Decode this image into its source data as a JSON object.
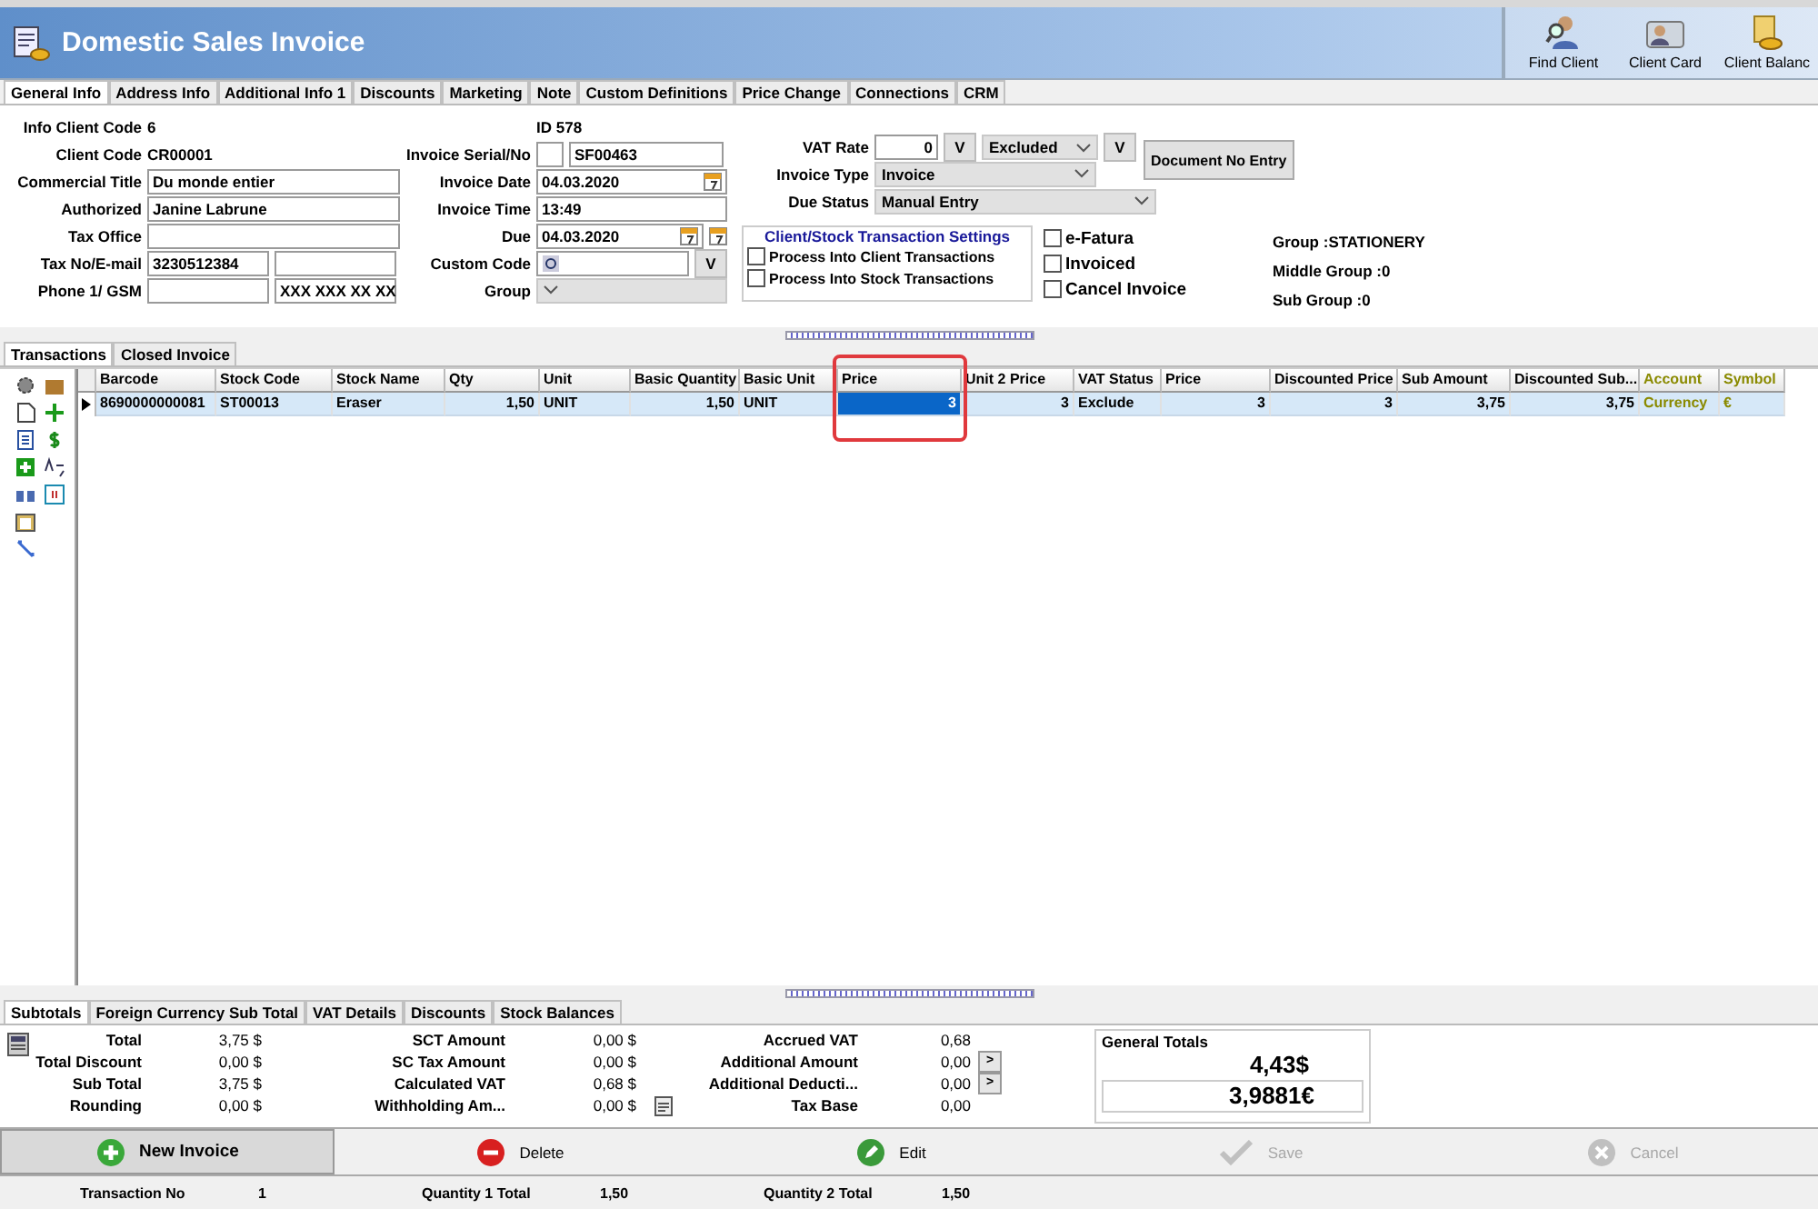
{
  "window": {
    "title": "Domestic Sales Invoice"
  },
  "header_buttons": [
    {
      "label": "Find Client",
      "kind": "find"
    },
    {
      "label": "Client Card",
      "kind": "card"
    },
    {
      "label": "Client Balanc",
      "kind": "balance"
    }
  ],
  "tabs": [
    {
      "label": "General Info",
      "selected": true
    },
    {
      "label": "Address Info",
      "selected": false
    },
    {
      "label": "Additional Info 1",
      "selected": false
    },
    {
      "label": "Discounts",
      "selected": false
    },
    {
      "label": "Marketing",
      "selected": false
    },
    {
      "label": "Note",
      "selected": false
    },
    {
      "label": "Custom Definitions",
      "selected": false
    },
    {
      "label": "Price Change",
      "selected": false
    },
    {
      "label": "Connections",
      "selected": false
    },
    {
      "label": "CRM",
      "selected": false
    }
  ],
  "client": {
    "info_client_code": {
      "label": "Info Client Code",
      "value": "6"
    },
    "client_code": {
      "label": "Client Code",
      "value": "CR00001"
    },
    "fields": [
      {
        "label": "Commercial Title",
        "inputs": [
          {
            "value": "Du monde entier"
          }
        ]
      },
      {
        "label": "Authorized",
        "inputs": [
          {
            "value": "Janine Labrune"
          }
        ]
      },
      {
        "label": "Tax Office",
        "inputs": [
          {
            "kind": "text"
          }
        ]
      },
      {
        "label": "Tax No/E-mail",
        "inputs": [
          {
            "value": "3230512384"
          },
          {
            "kind": "text"
          }
        ]
      },
      {
        "label": "Phone 1/ GSM",
        "inputs": [
          {
            "kind": "text"
          },
          {
            "value": "XXX XXX XX XX"
          }
        ]
      }
    ]
  },
  "invoice": {
    "id": "ID 578",
    "fields": [
      {
        "label": "Invoice Serial/No",
        "kind": "serial",
        "inputs": [
          {
            "kind": "text"
          },
          {
            "value": "SF00463"
          }
        ]
      },
      {
        "label": "Invoice Date",
        "kind": "date",
        "inputs": [
          {
            "value": "04.03.2020"
          }
        ]
      },
      {
        "label": "Invoice Time",
        "kind": "text",
        "inputs": [
          {
            "value": "13:49"
          }
        ]
      },
      {
        "label": "Due",
        "kind": "due",
        "inputs": [
          {
            "value": "04.03.2020"
          }
        ]
      },
      {
        "label": "Custom Code",
        "kind": "lookup",
        "inputs": [
          {
            "kind": "text"
          }
        ],
        "button": "V"
      },
      {
        "label": "Group",
        "kind": "dropdown",
        "inputs": [
          {
            "kind": "dropdown"
          }
        ]
      }
    ]
  },
  "vat": {
    "label": "VAT Rate",
    "value": "0",
    "button": "V",
    "mode": "Excluded",
    "mode_button": "V"
  },
  "document_button": "Document No Entry",
  "invoice_type": {
    "label": "Invoice Type",
    "value": "Invoice"
  },
  "due_status": {
    "label": "Due Status",
    "value": "Manual Entry"
  },
  "settings": {
    "title": "Client/Stock Transaction Settings",
    "options": [
      {
        "label": "Process Into Client Transactions",
        "checked": false
      },
      {
        "label": "Process Into Stock Transactions",
        "checked": false
      }
    ]
  },
  "flags": [
    {
      "label": "e-Fatura",
      "checked": false
    },
    {
      "label": "Invoiced",
      "checked": false
    },
    {
      "label": "Cancel Invoice",
      "checked": false
    }
  ],
  "groups": [
    "Group :STATIONERY",
    "Middle Group :0",
    "Sub Group :0"
  ],
  "grid_tabs": [
    {
      "label": "Transactions",
      "selected": true
    },
    {
      "label": "Closed Invoice",
      "selected": false
    }
  ],
  "table": {
    "columns": [
      {
        "label": "Barcode",
        "kind": "text",
        "color": "#000000"
      },
      {
        "label": "Stock Code",
        "kind": "text",
        "color": "#000000"
      },
      {
        "label": "Stock Name",
        "kind": "text",
        "color": "#000000"
      },
      {
        "label": "Qty",
        "kind": "number",
        "color": "#000000"
      },
      {
        "label": "Unit",
        "kind": "text",
        "color": "#000000"
      },
      {
        "label": "Basic Quantity",
        "kind": "number",
        "color": "#000000"
      },
      {
        "label": "Basic Unit",
        "kind": "text",
        "color": "#000000"
      },
      {
        "label": "Price",
        "kind": "number",
        "color": "#000000"
      },
      {
        "label": "Unit 2 Price",
        "kind": "number",
        "color": "#000000"
      },
      {
        "label": "VAT Status",
        "kind": "text",
        "color": "#000000"
      },
      {
        "label": "Price",
        "kind": "number",
        "color": "#000000"
      },
      {
        "label": "Discounted Price",
        "kind": "number",
        "color": "#000000"
      },
      {
        "label": "Sub Amount",
        "kind": "number",
        "color": "#000000"
      },
      {
        "label": "Discounted Sub...",
        "kind": "number",
        "color": "#000000"
      },
      {
        "label": "Account",
        "kind": "text",
        "color": "#8a8a00"
      },
      {
        "label": "Symbol",
        "kind": "text",
        "color": "#8a8a00"
      }
    ],
    "rows": [
      {
        "selected": true,
        "cells": [
          {
            "text": "8690000000081",
            "focused": false
          },
          {
            "text": "ST00013",
            "focused": false
          },
          {
            "text": "Eraser",
            "focused": false
          },
          {
            "text": "1,50",
            "focused": false
          },
          {
            "text": "UNIT",
            "focused": false
          },
          {
            "text": "1,50",
            "focused": false
          },
          {
            "text": "UNIT",
            "focused": false
          },
          {
            "text": "3",
            "focused": true
          },
          {
            "text": "3",
            "focused": false
          },
          {
            "text": "Exclude",
            "focused": false
          },
          {
            "text": "3",
            "focused": false
          },
          {
            "text": "3",
            "focused": false
          },
          {
            "text": "3,75",
            "focused": false
          },
          {
            "text": "3,75",
            "focused": false
          },
          {
            "text": "Currency",
            "focused": false
          },
          {
            "text": "€",
            "focused": false
          }
        ]
      }
    ]
  },
  "subtotal_tabs": [
    {
      "label": "Subtotals",
      "selected": true
    },
    {
      "label": "Foreign Currency Sub Total",
      "selected": false
    },
    {
      "label": "VAT Details",
      "selected": false
    },
    {
      "label": "Discounts",
      "selected": false
    },
    {
      "label": "Stock Balances",
      "selected": false
    }
  ],
  "subtotals": [
    [
      {
        "label": "Total",
        "value": "3,75 $"
      },
      {
        "label": "Total Discount",
        "value": "0,00 $"
      },
      {
        "label": "Sub Total",
        "value": "3,75 $"
      },
      {
        "label": "Rounding",
        "value": "0,00 $"
      }
    ],
    [
      {
        "label": "SCT Amount",
        "value": "0,00 $"
      },
      {
        "label": "SC Tax Amount",
        "value": "0,00 $"
      },
      {
        "label": "Calculated VAT",
        "value": "0,68 $"
      },
      {
        "label": "Withholding Am...",
        "value": "0,00 $"
      }
    ],
    [
      {
        "label": "Accrued VAT",
        "value": "0,68"
      },
      {
        "label": "Additional Amount",
        "value": "0,00",
        "button": ">"
      },
      {
        "label": "Additional Deducti...",
        "value": "0,00",
        "button": ">"
      },
      {
        "label": "Tax Base",
        "value": "0,00",
        "icon": true
      }
    ]
  ],
  "general_totals": {
    "title": "General Totals",
    "primary": "4,43$",
    "secondary": "3,9881€"
  },
  "actions": [
    {
      "label": "New Invoice",
      "kind": "new",
      "disabled": false
    },
    {
      "label": "Delete",
      "kind": "delete",
      "disabled": false
    },
    {
      "label": "Edit",
      "kind": "edit",
      "disabled": false
    },
    {
      "label": "Save",
      "kind": "save",
      "disabled": true
    },
    {
      "label": "Cancel",
      "kind": "cancel",
      "disabled": true
    }
  ],
  "status_bar": [
    {
      "label": "Transaction No",
      "value": "1"
    },
    {
      "label": "Quantity 1 Total",
      "value": "1,50"
    },
    {
      "label": "Quantity 2 Total",
      "value": "1,50"
    }
  ]
}
